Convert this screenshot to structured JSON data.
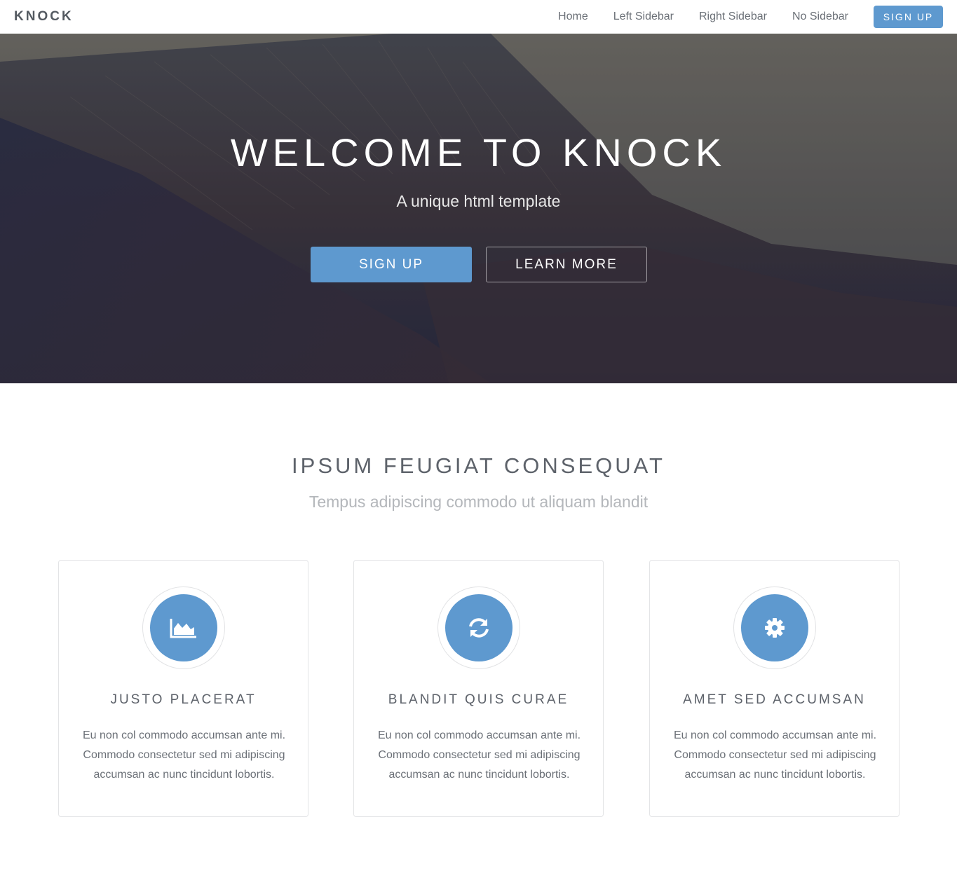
{
  "navbar": {
    "brand": "KNOCK",
    "links": [
      "Home",
      "Left Sidebar",
      "Right Sidebar",
      "No Sidebar"
    ],
    "cta_label": "SIGN UP"
  },
  "hero": {
    "title": "WELCOME TO KNOCK",
    "subtitle": "A unique html template",
    "primary_button": "SIGN UP",
    "secondary_button": "LEARN MORE"
  },
  "features": {
    "title": "IPSUM FEUGIAT CONSEQUAT",
    "subtitle": "Tempus adipiscing commodo ut aliquam blandit",
    "cards": [
      {
        "icon": "area-chart-icon",
        "title": "JUSTO PLACERAT",
        "text": "Eu non col commodo accumsan ante mi. Commodo consectetur sed mi adipiscing accumsan ac nunc tincidunt lobortis."
      },
      {
        "icon": "refresh-icon",
        "title": "BLANDIT QUIS CURAE",
        "text": "Eu non col commodo accumsan ante mi. Commodo consectetur sed mi adipiscing accumsan ac nunc tincidunt lobortis."
      },
      {
        "icon": "gear-icon",
        "title": "AMET SED ACCUMSAN",
        "text": "Eu non col commodo accumsan ante mi. Commodo consectetur sed mi adipiscing accumsan ac nunc tincidunt lobortis."
      }
    ]
  },
  "colors": {
    "accent": "#5e99cf",
    "heading": "#5d626a",
    "muted": "#b4b7bb"
  }
}
